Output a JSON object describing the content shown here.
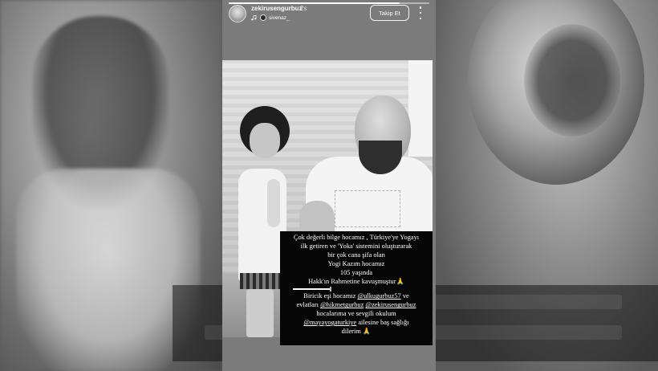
{
  "story": {
    "username": "zekirusengurbuz",
    "time_ago": "2s",
    "music_icon": "music-note-icon",
    "music_user": "sivenaz_",
    "follow_label": "Takip Et",
    "progress": 0.85
  },
  "caption": {
    "lines": [
      "Çok değerli bilge hocamız , Türkiye'ye Yogayı",
      "ilk getiren  ve 'Yoka' sistemini oluşturarak",
      "bir çok cana şifa olan",
      "Yogi Kazım hocamız",
      "105 yaşında",
      "Hakk'ın Rahmetine kavuşmuştur"
    ],
    "emoji_pray": "🙏",
    "line7_prefix": "Biricik eşi hocamız ",
    "mention_1": "@ulkugurbuz57",
    "line7_suffix": "  ve",
    "line8_prefix": "evlatları ",
    "mention_2": "@hikmetgurbuz",
    "mention_3": "@zekirusengurbuz",
    "line9": "hocalarıma ve sevgili okulum",
    "mention_4": "@mayayogaturkiye",
    "line10_suffix": "  ailesine baş sağlığı",
    "line11": "dilerim"
  },
  "colors": {
    "caption_bg": "#060606",
    "caption_text": "#ffffff",
    "story_bg": "#7b7b7b"
  }
}
